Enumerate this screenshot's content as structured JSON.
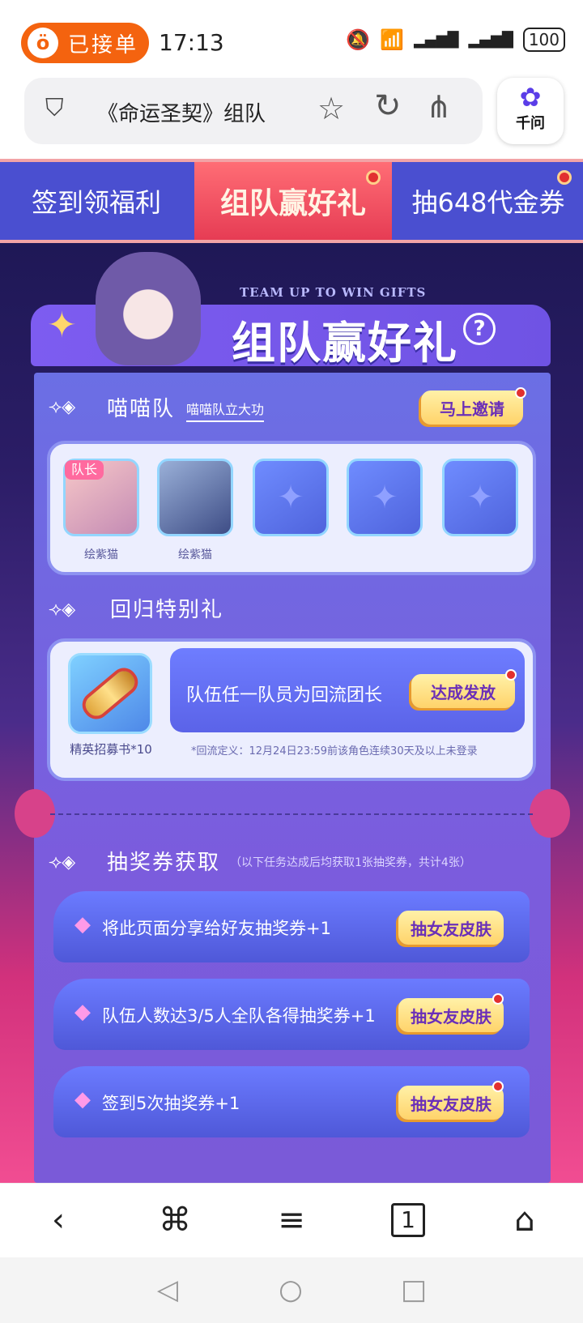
{
  "status": {
    "order_label": "已接单",
    "order_icon": "ö",
    "time": "17:13",
    "mute_icon": "🔕",
    "wifi_icon": "📶",
    "signal_icon": "▂▄▆█",
    "battery": "100"
  },
  "address_bar": {
    "title": "《命运圣契》组队",
    "shield_icon": "⛉",
    "star_icon": "☆",
    "reload_icon": "↻",
    "share_icon": "⋔"
  },
  "assistant": {
    "icon": "✿",
    "label": "千问"
  },
  "tabs": [
    {
      "label": "签到领福利"
    },
    {
      "label": "组队赢好礼"
    },
    {
      "label": "抽648代金券"
    }
  ],
  "header": {
    "subtitle": "TEAM UP TO WIN GIFTS",
    "title": "组队赢好礼",
    "help": "?",
    "sparkle": "✦"
  },
  "team": {
    "mark": "⟢◈",
    "name": "喵喵队",
    "subtitle": "喵喵队立大功",
    "invite_label": "马上邀请",
    "leader_tag": "队长",
    "members": [
      {
        "name": "绘紫猫"
      },
      {
        "name": "绘紫猫"
      }
    ],
    "empty_icon": "✦"
  },
  "return_gift": {
    "mark": "⟢◈",
    "title": "回归特别礼",
    "item_label": "精英招募书*10",
    "description": "队伍任一队员为回流团长",
    "button": "达成发放",
    "note": "*回流定义：12月24日23:59前该角色连续30天及以上未登录"
  },
  "lottery": {
    "mark": "⟢◈",
    "title": "抽奖券获取",
    "note": "（以下任务达成后均获取1张抽奖券，共计4张）",
    "tasks": [
      {
        "label": "将此页面分享给好友抽奖券+1",
        "button": "抽女友皮肤"
      },
      {
        "label": "队伍人数达3/5人全队各得抽奖券+1",
        "button": "抽女友皮肤"
      },
      {
        "label": "签到5次抽奖券+1",
        "button": "抽女友皮肤"
      }
    ],
    "task_icon": "◆"
  },
  "bottom_nav": {
    "back": "‹",
    "menu": "⌘",
    "list": "≡",
    "tabs": "1",
    "home": "⌂"
  },
  "system_nav": {
    "back": "◁",
    "home": "○",
    "recent": "□"
  }
}
